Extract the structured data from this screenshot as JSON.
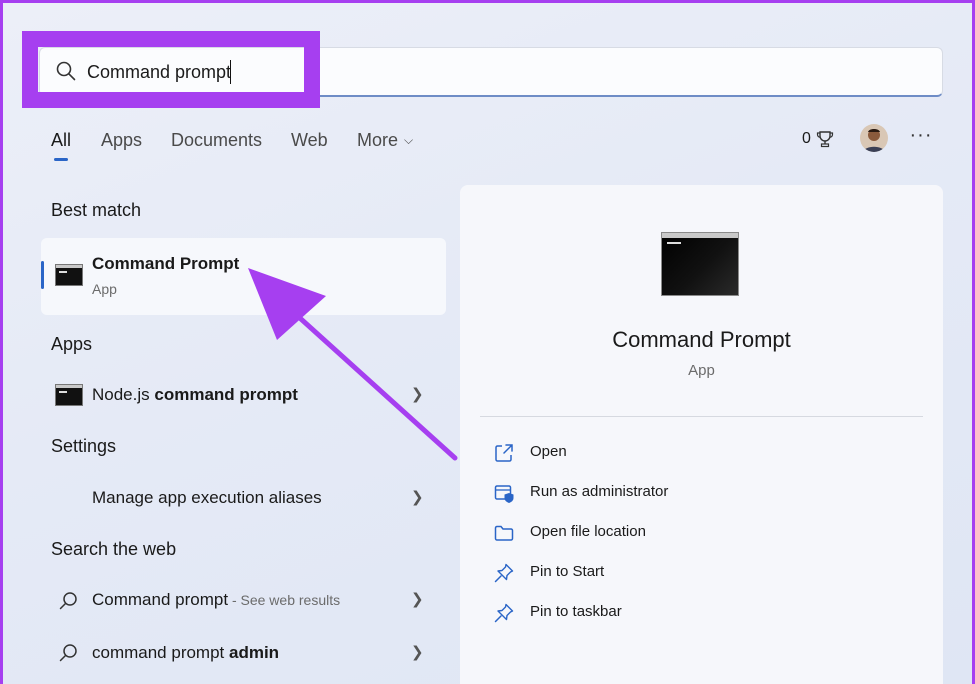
{
  "search": {
    "value": "Command prompt"
  },
  "tabs": [
    {
      "label": "All"
    },
    {
      "label": "Apps"
    },
    {
      "label": "Documents"
    },
    {
      "label": "Web"
    },
    {
      "label": "More"
    }
  ],
  "header": {
    "rewards_count": "0"
  },
  "best_match": {
    "section_title": "Best match",
    "title": "Command Prompt",
    "subtitle": "App"
  },
  "apps": {
    "section_title": "Apps",
    "items": [
      {
        "title_normal": "Node.js ",
        "title_bold": "command prompt"
      }
    ]
  },
  "settings": {
    "section_title": "Settings",
    "items": [
      {
        "title": "Manage app execution aliases"
      }
    ]
  },
  "web": {
    "section_title": "Search the web",
    "items": [
      {
        "title": "Command prompt",
        "suffix": " - See web results"
      },
      {
        "title_normal": "command prompt ",
        "title_bold": "admin"
      }
    ]
  },
  "details": {
    "title": "Command Prompt",
    "subtitle": "App",
    "actions": [
      {
        "label": "Open",
        "icon": "open-external-icon"
      },
      {
        "label": "Run as administrator",
        "icon": "shield-admin-icon"
      },
      {
        "label": "Open file location",
        "icon": "folder-icon"
      },
      {
        "label": "Pin to Start",
        "icon": "pin-icon"
      },
      {
        "label": "Pin to taskbar",
        "icon": "pin-icon"
      }
    ]
  },
  "colors": {
    "highlight": "#a63ff0",
    "accent": "#2a65c7"
  }
}
